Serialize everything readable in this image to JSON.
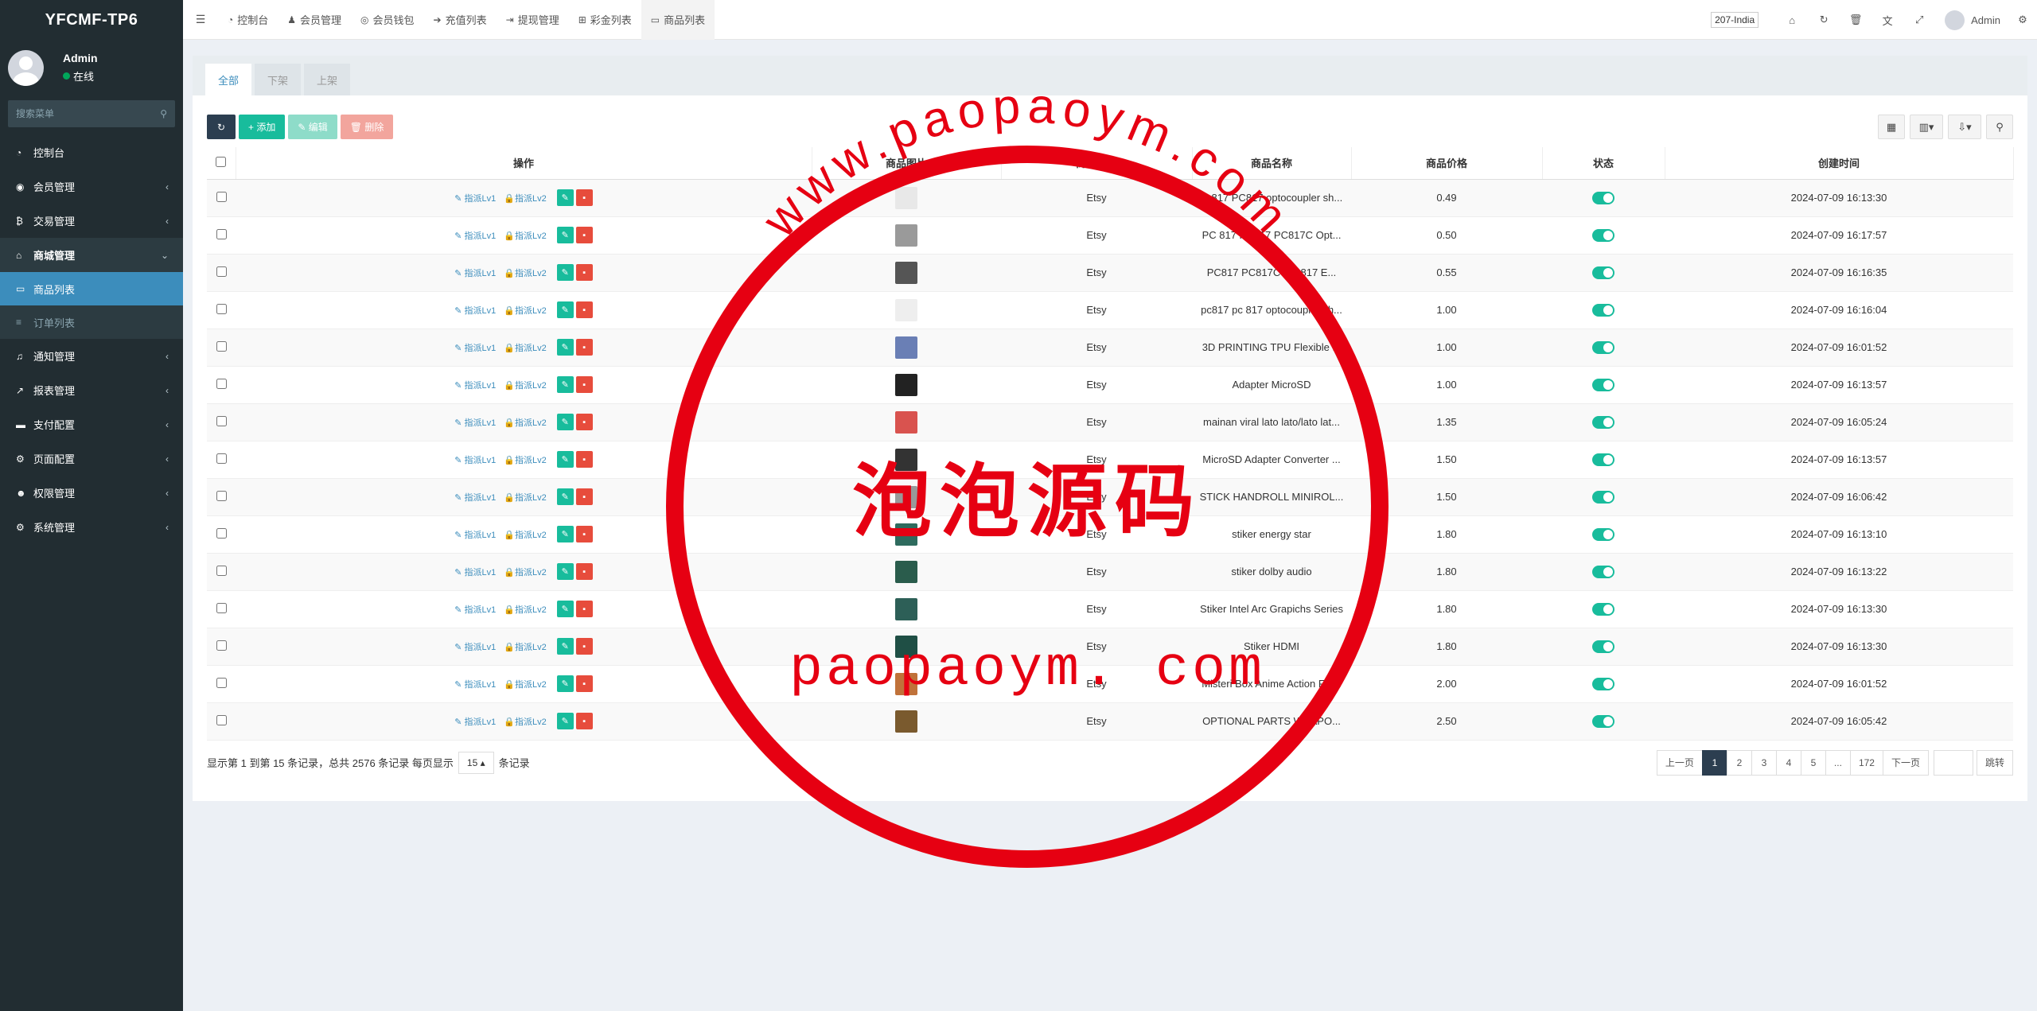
{
  "app": {
    "title": "YFCMF-TP6"
  },
  "user": {
    "name": "Admin",
    "status": "在线"
  },
  "search": {
    "placeholder": "搜索菜单"
  },
  "sidebar": {
    "items": [
      {
        "label": "控制台",
        "icon": "dashboard-icon"
      },
      {
        "label": "会员管理",
        "icon": "user-circle-icon"
      },
      {
        "label": "交易管理",
        "icon": "bitcoin-icon"
      },
      {
        "label": "商城管理",
        "icon": "home-icon"
      },
      {
        "label": "商品列表",
        "icon": "desktop-icon"
      },
      {
        "label": "订单列表",
        "icon": "list-icon"
      },
      {
        "label": "通知管理",
        "icon": "bell-icon"
      },
      {
        "label": "报表管理",
        "icon": "line-chart-icon"
      },
      {
        "label": "支付配置",
        "icon": "credit-card-icon"
      },
      {
        "label": "页面配置",
        "icon": "gear-icon"
      },
      {
        "label": "权限管理",
        "icon": "group-icon"
      },
      {
        "label": "系统管理",
        "icon": "cogs-icon"
      }
    ]
  },
  "topnav": {
    "tabs": [
      {
        "label": "控制台",
        "icon": "dashboard-icon"
      },
      {
        "label": "会员管理",
        "icon": "user-icon"
      },
      {
        "label": "会员钱包",
        "icon": "wallet-icon"
      },
      {
        "label": "充值列表",
        "icon": "sign-in-icon"
      },
      {
        "label": "提现管理",
        "icon": "sign-out-icon"
      },
      {
        "label": "彩金列表",
        "icon": "gift-icon"
      },
      {
        "label": "商品列表",
        "icon": "desktop-icon"
      }
    ],
    "region": "207-India",
    "admin": "Admin"
  },
  "filter_tabs": [
    "全部",
    "下架",
    "上架"
  ],
  "toolbar": {
    "add": "添加",
    "edit": "编辑",
    "delete": "删除"
  },
  "table": {
    "headers": [
      "操作",
      "商品图片",
      "商店名称",
      "商品名称",
      "商品价格",
      "状态",
      "创建时间"
    ],
    "op_lv1": "指派Lv1",
    "op_lv2": "指派Lv2",
    "rows": [
      {
        "store": "Etsy",
        "name": "pc817 PC817 optocoupler sh...",
        "price": "0.49",
        "created": "2024-07-09 16:13:30",
        "thumb": "#e8e8e8"
      },
      {
        "store": "Etsy",
        "name": "PC 817 PC817 PC817C Opt...",
        "price": "0.50",
        "created": "2024-07-09 16:17:57",
        "thumb": "#9a9a9a"
      },
      {
        "store": "Etsy",
        "name": "PC817 PC817C PC 817 E...",
        "price": "0.55",
        "created": "2024-07-09 16:16:35",
        "thumb": "#555555"
      },
      {
        "store": "Etsy",
        "name": "pc817 pc 817 optocoupler sh...",
        "price": "1.00",
        "created": "2024-07-09 16:16:04",
        "thumb": "#eeeeee"
      },
      {
        "store": "Etsy",
        "name": "3D PRINTING TPU Flexible ...",
        "price": "1.00",
        "created": "2024-07-09 16:01:52",
        "thumb": "#6a7fb5"
      },
      {
        "store": "Etsy",
        "name": "Adapter MicroSD",
        "price": "1.00",
        "created": "2024-07-09 16:13:57",
        "thumb": "#222222"
      },
      {
        "store": "Etsy",
        "name": "mainan viral lato lato/lato lat...",
        "price": "1.35",
        "created": "2024-07-09 16:05:24",
        "thumb": "#d9534f"
      },
      {
        "store": "Etsy",
        "name": "MicroSD Adapter Converter ...",
        "price": "1.50",
        "created": "2024-07-09 16:13:57",
        "thumb": "#333333"
      },
      {
        "store": "Etsy",
        "name": "STICK HANDROLL MINIROL...",
        "price": "1.50",
        "created": "2024-07-09 16:06:42",
        "thumb": "#999999"
      },
      {
        "store": "Etsy",
        "name": "stiker energy star",
        "price": "1.80",
        "created": "2024-07-09 16:13:10",
        "thumb": "#2e6b5e"
      },
      {
        "store": "Etsy",
        "name": "stiker dolby audio",
        "price": "1.80",
        "created": "2024-07-09 16:13:22",
        "thumb": "#2a5c4c"
      },
      {
        "store": "Etsy",
        "name": "Stiker Intel Arc Grapichs Series",
        "price": "1.80",
        "created": "2024-07-09 16:13:30",
        "thumb": "#2d5f57"
      },
      {
        "store": "Etsy",
        "name": "Stiker HDMI",
        "price": "1.80",
        "created": "2024-07-09 16:13:30",
        "thumb": "#1f4f45"
      },
      {
        "store": "Etsy",
        "name": "Misteri Box Anime Action Fig...",
        "price": "2.00",
        "created": "2024-07-09 16:01:52",
        "thumb": "#c0723a"
      },
      {
        "store": "Etsy",
        "name": "OPTIONAL PARTS WEAPO...",
        "price": "2.50",
        "created": "2024-07-09 16:05:42",
        "thumb": "#7a5a2e"
      }
    ]
  },
  "pagination": {
    "info_prefix": "显示第 1 到第 15 条记录，总共 2576 条记录 每页显示",
    "page_size": "15",
    "info_suffix": "条记录",
    "prev": "上一页",
    "pages": [
      "1",
      "2",
      "3",
      "4",
      "5",
      "...",
      "172"
    ],
    "next": "下一页",
    "jump": "跳转"
  },
  "watermark": {
    "top_arc": "www.paopaoym.com",
    "center": "泡泡源码",
    "bottom": "paopaoym. com",
    "color": "#e60012"
  }
}
